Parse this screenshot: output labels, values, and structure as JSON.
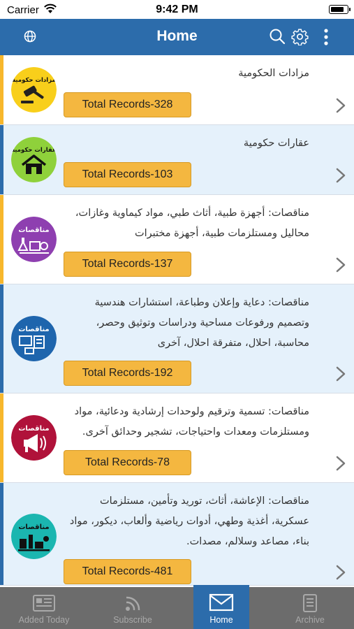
{
  "status_bar": {
    "carrier": "Carrier",
    "time": "9:42 PM",
    "battery_level": 0.8
  },
  "header": {
    "title": "Home",
    "icons": [
      "globe-icon",
      "search-icon",
      "gear-icon",
      "more-vertical-icon"
    ]
  },
  "colors": {
    "primary": "#2c6cab",
    "accent_yellow": "#f7b72c",
    "button": "#f4b740",
    "row_alt": "#e5f1fb",
    "tabbar": "#6c6c6c"
  },
  "rows": [
    {
      "description": "مزادات الحكومية",
      "records": "Total Records-328",
      "logo_text": "مزادات حكومية",
      "logo_icon": "gavel-icon"
    },
    {
      "description": "عقارات حكومية",
      "records": "Total Records-103",
      "logo_text": "عقارات حكومية",
      "logo_icon": "house-icon"
    },
    {
      "description": "مناقصات: أجهزة طبية، أثاث طبي، مواد كيماوية وغازات، محاليل ومستلزمات طبية، أجهزة مختبرات",
      "records": "Total Records-137",
      "logo_text": "مناقصات",
      "logo_icon": "lab-equipment-icon"
    },
    {
      "description": "مناقصات: دعاية وإعلان وطباعة، استشارات هندسية وتصميم ورفوعات مساحية ودراسات وتوثيق وحصر، محاسبة، احلال، متفرقة احلال، آخرى",
      "records": "Total Records-192",
      "logo_text": "مناقصات",
      "logo_icon": "office-icon"
    },
    {
      "description": "مناقصات: تسمية وترقيم ولوحدات إرشادية ودعائية، مواد ومستلزمات ومعدات واحتياجات، تشجير وحدائق آخرى.",
      "records": "Total Records-78",
      "logo_text": "مناقصات",
      "logo_icon": "megaphone-icon"
    },
    {
      "description": "مناقصات: الإعاشة، أثاث، توريد وتأمين، مستلزمات عسكرية، أغذية وطهي، أدوات رياضية وألعاب، ديكور، مواد بناء، مصاعد وسلالم، مصدات.",
      "records": "Total Records-481",
      "logo_text": "مناقصات",
      "logo_icon": "supplies-icon"
    }
  ],
  "tabs": [
    {
      "label": "Added Today",
      "icon": "newspaper-icon",
      "active": false
    },
    {
      "label": "Subscribe",
      "icon": "rss-icon",
      "active": false
    },
    {
      "label": "Home",
      "icon": "envelope-icon",
      "active": true
    },
    {
      "label": "Archive",
      "icon": "document-icon",
      "active": false
    }
  ]
}
